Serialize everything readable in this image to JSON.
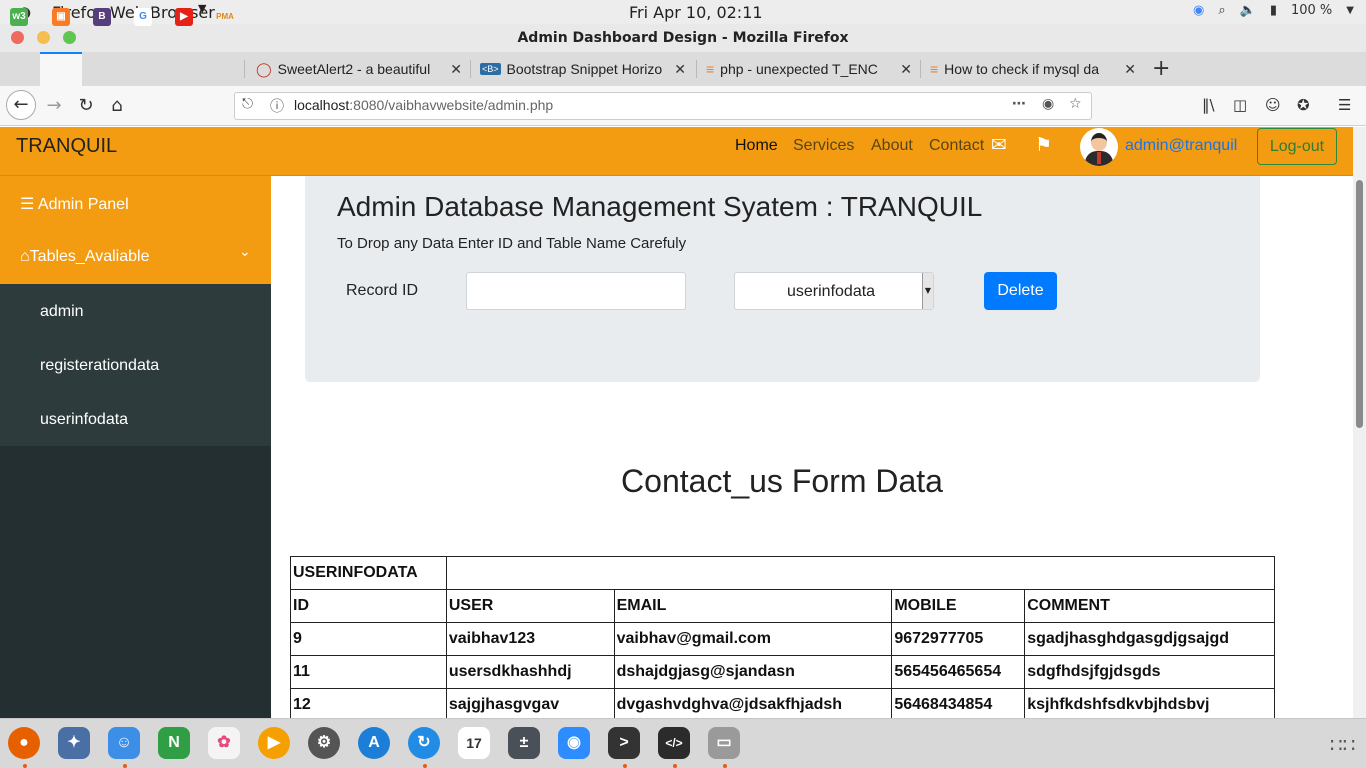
{
  "os": {
    "app_name": "Firefox Web Browser",
    "clock": "Fri Apr 10, 02:11",
    "battery": "100 %"
  },
  "window": {
    "title": "Admin Dashboard Design - Mozilla Firefox"
  },
  "tabs": [
    {
      "label": "SweetAlert2 - a beautiful"
    },
    {
      "label": "Bootstrap Snippet Horizo"
    },
    {
      "label": "php - unexpected T_ENC"
    },
    {
      "label": "How to check if mysql da"
    }
  ],
  "address_bar": {
    "host": "localhost",
    "path": ":8080/vaibhavwebsite/admin.php"
  },
  "navbar": {
    "brand": "TRANQUIL",
    "links": [
      "Home",
      "Services",
      "About",
      "Contact"
    ],
    "user_email": "admin@tranquil",
    "logout_label": "Log-out"
  },
  "sidebar": {
    "admin_panel": "Admin Panel",
    "tables_header": "Tables_Avaliable",
    "items": [
      "admin",
      "registerationdata",
      "userinfodata"
    ]
  },
  "panel": {
    "title": "Admin Database Management Syatem : TRANQUIL",
    "subtitle": "To Drop any Data Enter ID and Table Name Carefuly",
    "record_label": "Record ID",
    "record_value": "",
    "selected_table": "userinfodata",
    "delete_label": "Delete"
  },
  "section_title": "Contact_us Form Data",
  "table": {
    "caption": "USERINFODATA",
    "headers": [
      "ID",
      "USER",
      "EMAIL",
      "MOBILE",
      "COMMENT"
    ],
    "rows": [
      [
        "9",
        "vaibhav123",
        "vaibhav@gmail.com",
        "9672977705",
        "sgadjhasghdgasgdjgsajgd"
      ],
      [
        "11",
        "usersdkhashhdj",
        "dshajdgjasg@sjandasn",
        "565456465654",
        "sdgfhdsjfgjdsgds"
      ],
      [
        "12",
        "sajgjhasgvgav",
        "dvgashvdghva@jdsakfhjadsh",
        "56468434854",
        "ksjhfkdshfsdkvbjhdsbvj"
      ]
    ]
  },
  "colors": {
    "navbar": "#f39c12",
    "sidebar": "#232f30",
    "primary": "#007bff"
  }
}
